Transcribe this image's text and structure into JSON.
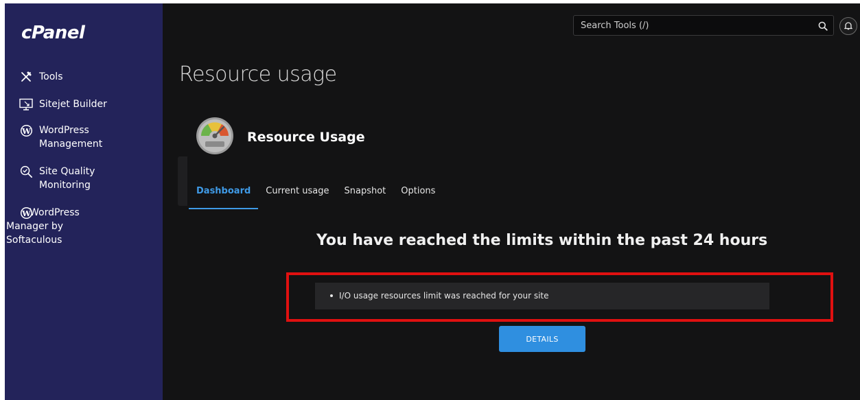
{
  "sidebar": {
    "logo": "cPanel",
    "items": [
      {
        "label": "Tools",
        "icon": "tools-icon"
      },
      {
        "label": "Sitejet Builder",
        "icon": "monitor-icon"
      },
      {
        "label": "WordPress\nManagement",
        "icon": "wordpress-icon"
      },
      {
        "label": "Site Quality\nMonitoring",
        "icon": "magnifier-check-icon"
      },
      {
        "label": "WordPress Manager by Softaculous",
        "icon": "wordpress-icon"
      }
    ]
  },
  "topbar": {
    "search_placeholder": "Search Tools (/)",
    "search_icon": "search-icon",
    "notification_icon": "bell-icon"
  },
  "page": {
    "title": "Resource usage",
    "app_title": "Resource Usage",
    "app_icon": "gauge-icon",
    "tabs": [
      "Dashboard",
      "Current usage",
      "Snapshot",
      "Options"
    ],
    "active_tab": "Dashboard",
    "heading": "You have reached the limits within the past 24 hours",
    "alerts": [
      "I/O usage resources limit was reached for your site"
    ],
    "details_button": "DETAILS"
  },
  "colors": {
    "sidebar_bg": "#23235a",
    "page_bg": "#131314",
    "accent": "#3f9ae6",
    "button": "#2f8fe0",
    "highlight": "#e01010"
  }
}
